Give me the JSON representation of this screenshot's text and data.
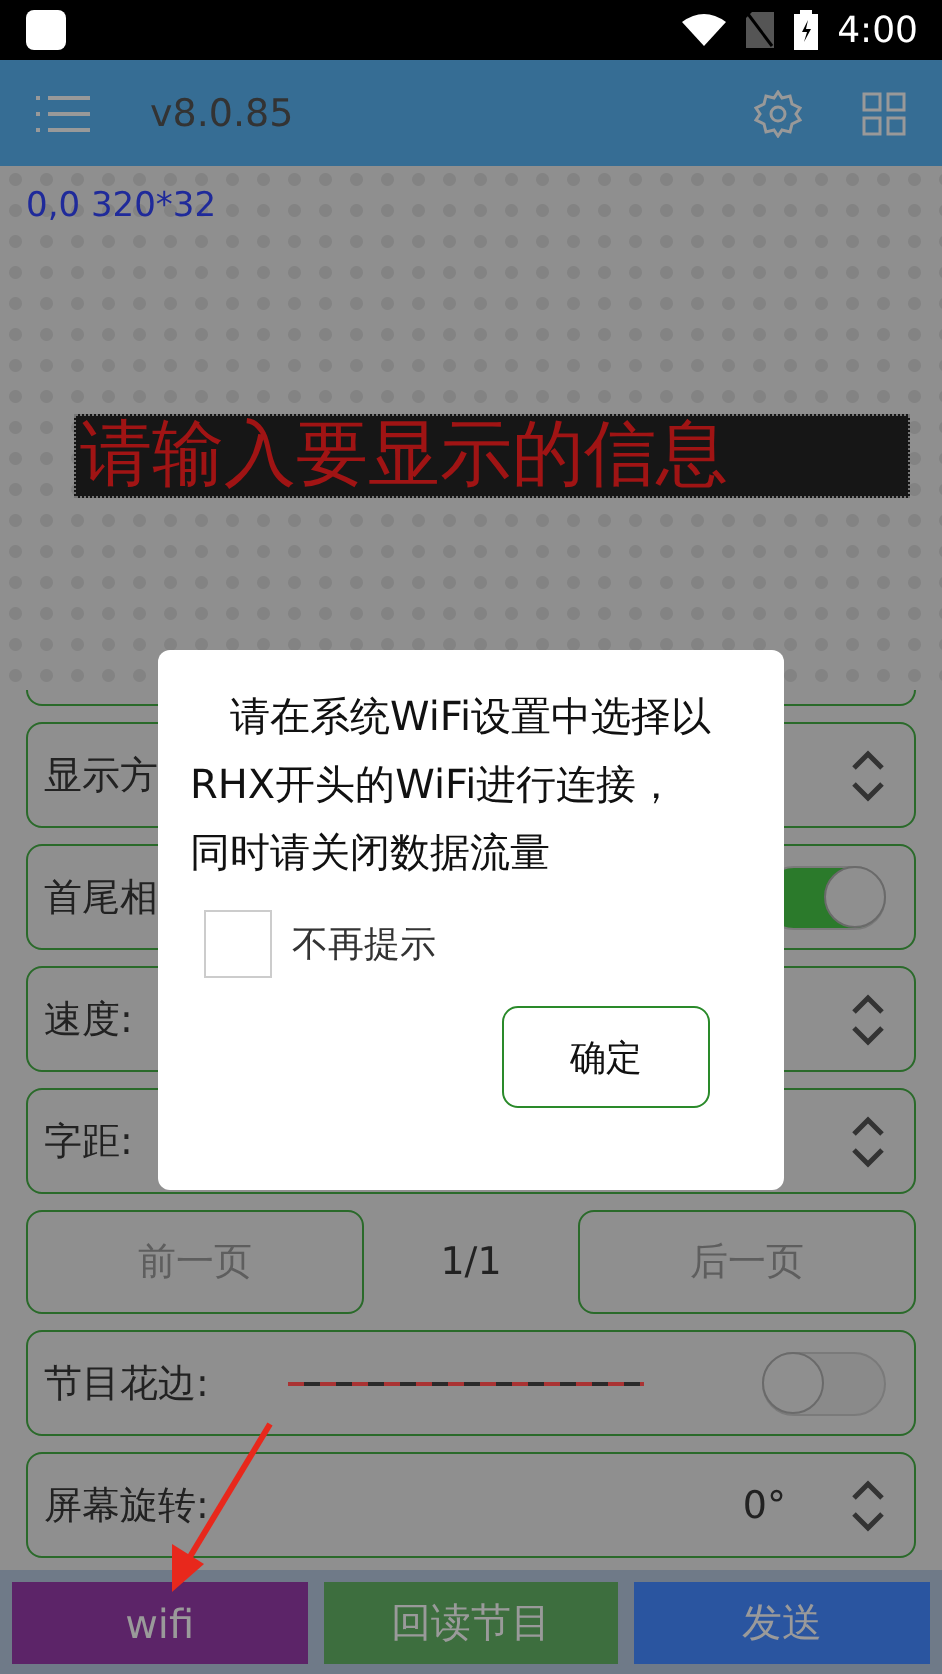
{
  "status_bar": {
    "time": "4:00"
  },
  "toolbar": {
    "version": "v8.0.85"
  },
  "preview": {
    "info": "0,0 320*32",
    "led_text": "请输入要显示的信息"
  },
  "settings": [
    {
      "kind": "select",
      "label": "显示方"
    },
    {
      "kind": "toggle",
      "label": "首尾相",
      "on": true
    },
    {
      "kind": "select",
      "label": "速度:"
    },
    {
      "kind": "select",
      "label": "字距:"
    }
  ],
  "pager": {
    "prev": {
      "label": "前一页",
      "disabled": true
    },
    "page": "1/1",
    "next": {
      "label": "后一页",
      "disabled": true
    }
  },
  "border_row": {
    "label": "节目花边:",
    "on": false
  },
  "rotation_row": {
    "label": "屏幕旋转:",
    "value": "0°"
  },
  "buttons": [
    {
      "label": "wifi",
      "color": "#5c2468"
    },
    {
      "label": "回读节目",
      "color": "#3d6e3e"
    },
    {
      "label": "发送",
      "color": "#2a55a0"
    }
  ],
  "dialog": {
    "message": "请在系统WiFi设置中选择以RHX开头的WiFi进行连接，同时请关闭数据流量",
    "checkbox": {
      "label": "不再提示",
      "checked": false
    },
    "ok": "确定"
  }
}
